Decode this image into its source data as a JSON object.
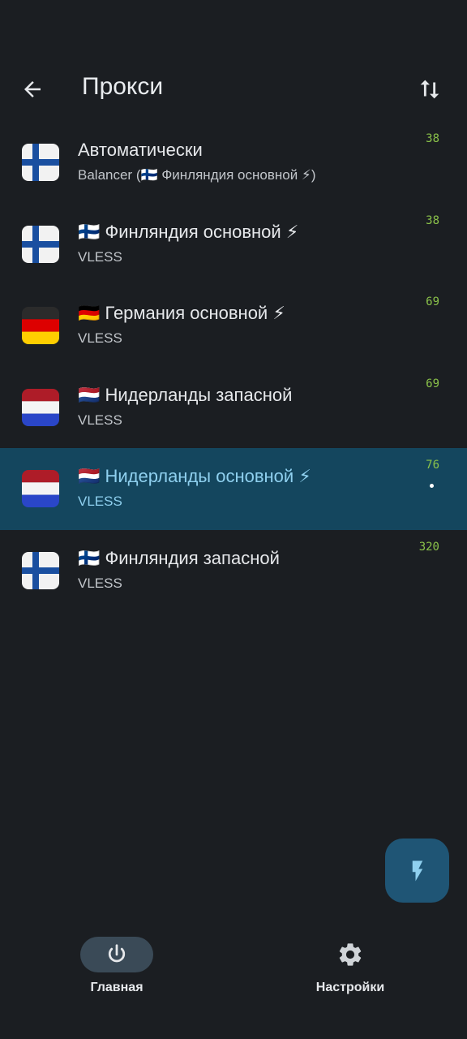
{
  "header": {
    "title": "Прокси",
    "back_icon": "arrow-left-icon",
    "sort_icon": "sort-arrows-icon"
  },
  "proxies": [
    {
      "flag": "fi",
      "name": "Автоматически",
      "sub": "Balancer (🇫🇮 Финляндия основной ⚡)",
      "ping": "38",
      "selected": false
    },
    {
      "flag": "fi",
      "name": "🇫🇮 Финляндия основной ⚡",
      "sub": "VLESS",
      "ping": "38",
      "selected": false
    },
    {
      "flag": "de",
      "name": "🇩🇪 Германия основной ⚡",
      "sub": "VLESS",
      "ping": "69",
      "selected": false
    },
    {
      "flag": "nl",
      "name": "🇳🇱 Нидерланды запасной",
      "sub": "VLESS",
      "ping": "69",
      "selected": false
    },
    {
      "flag": "nl",
      "name": "🇳🇱 Нидерланды основной ⚡",
      "sub": "VLESS",
      "ping": "76",
      "selected": true
    },
    {
      "flag": "fi",
      "name": "🇫🇮 Финляндия запасной",
      "sub": "VLESS",
      "ping": "320",
      "selected": false
    }
  ],
  "fab": {
    "icon": "lightning-icon"
  },
  "nav": {
    "home": {
      "label": "Главная",
      "icon": "power-icon",
      "active": true
    },
    "settings": {
      "label": "Настройки",
      "icon": "gear-icon",
      "active": false
    }
  },
  "colors": {
    "background": "#1b1e22",
    "selected_row": "#14465e",
    "ping": "#8bc34a",
    "fab": "#1f5575"
  }
}
